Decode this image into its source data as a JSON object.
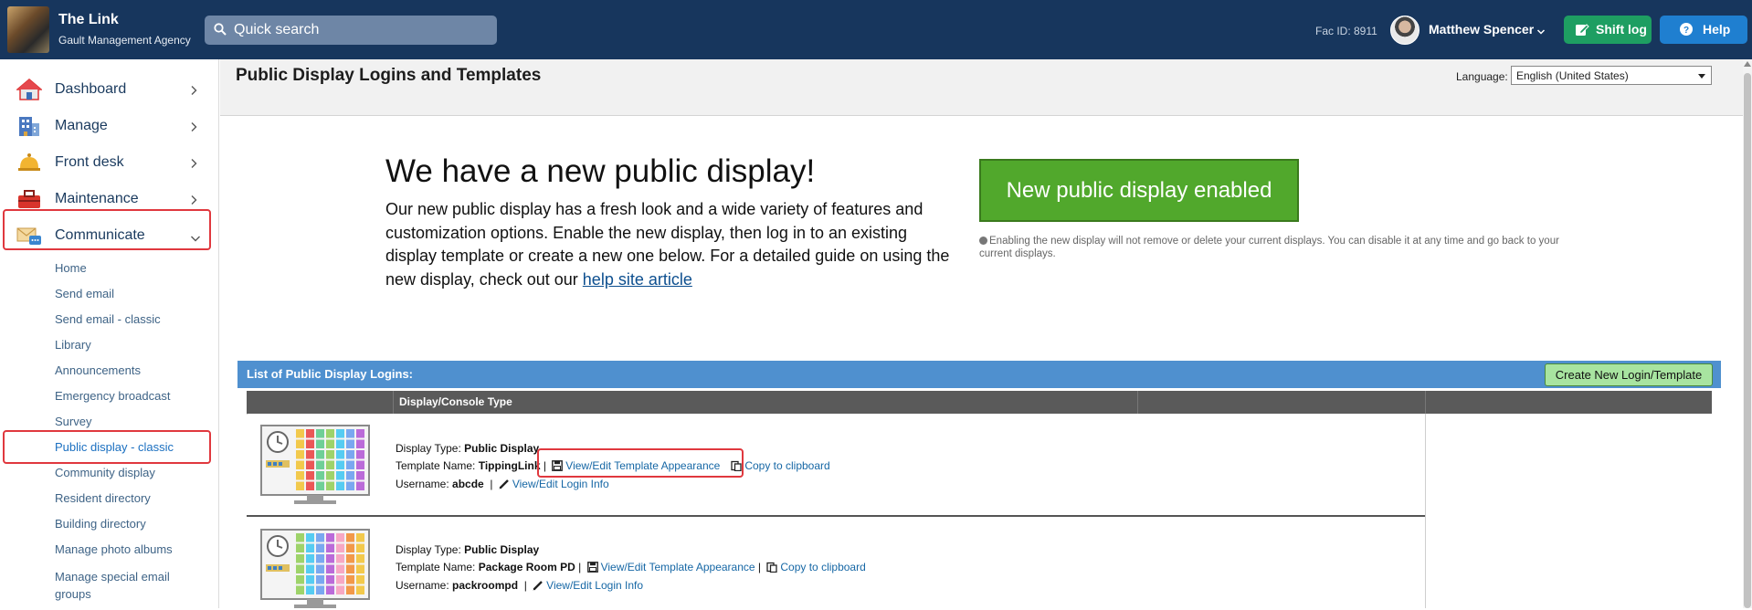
{
  "header": {
    "brand_title": "The Link",
    "brand_subtitle": "Gault Management Agency",
    "search_placeholder": "Quick search",
    "fac_id": "Fac ID: 8911",
    "user_name": "Matthew Spencer",
    "shift_log_label": "Shift log",
    "help_label": "Help",
    "colors": {
      "bar": "#17365d",
      "shift_log": "#1e9e62",
      "help": "#1f7fd0"
    }
  },
  "sidebar": {
    "items": [
      {
        "label": "Dashboard",
        "icon": "house-icon"
      },
      {
        "label": "Manage",
        "icon": "building-icon"
      },
      {
        "label": "Front desk",
        "icon": "bell-icon"
      },
      {
        "label": "Maintenance",
        "icon": "toolbox-icon"
      },
      {
        "label": "Communicate",
        "icon": "envelope-chat-icon",
        "expanded": true,
        "highlighted": true
      }
    ],
    "sub_items": [
      {
        "label": "Home"
      },
      {
        "label": "Send email"
      },
      {
        "label": "Send email - classic"
      },
      {
        "label": "Library"
      },
      {
        "label": "Announcements"
      },
      {
        "label": "Emergency broadcast"
      },
      {
        "label": "Survey"
      },
      {
        "label": "Public display - classic",
        "active": true,
        "highlighted": true
      },
      {
        "label": "Community display"
      },
      {
        "label": "Resident directory"
      },
      {
        "label": "Building directory"
      },
      {
        "label": "Manage photo albums"
      },
      {
        "label": "Manage special email groups"
      }
    ]
  },
  "page": {
    "title": "Public Display Logins and Templates",
    "language_label": "Language:",
    "language_value": "English (United States)"
  },
  "promo": {
    "heading": "We have a new public display!",
    "body": "Our new public display has a fresh look and a wide variety of features and customization options. Enable the new display, then log in to an existing display template or create a new one below. For a detailed guide on using the new display, check out our",
    "link_text": "help site article",
    "button_label": "New public display enabled",
    "note": "Enabling the new display will not remove or delete your current displays. You can disable it at any time and go back to your current displays.",
    "button_color": "#51a82c"
  },
  "list": {
    "title": "List of Public Display Logins:",
    "create_button": "Create New Login/Template",
    "column_header": "Display/Console Type",
    "display_type_label": "Display Type:",
    "template_name_label": "Template Name:",
    "username_label": "Username:",
    "view_edit_template": "View/Edit Template Appearance",
    "copy_clipboard": "Copy to clipboard",
    "view_edit_login": "View/Edit Login Info",
    "rows": [
      {
        "display_type": "Public Display",
        "template_name": "TippingLink",
        "username": "abcde",
        "highlighted_action": true
      },
      {
        "display_type": "Public Display",
        "template_name": "Package Room PD",
        "username": "packroompd",
        "highlighted_action": false
      }
    ]
  }
}
